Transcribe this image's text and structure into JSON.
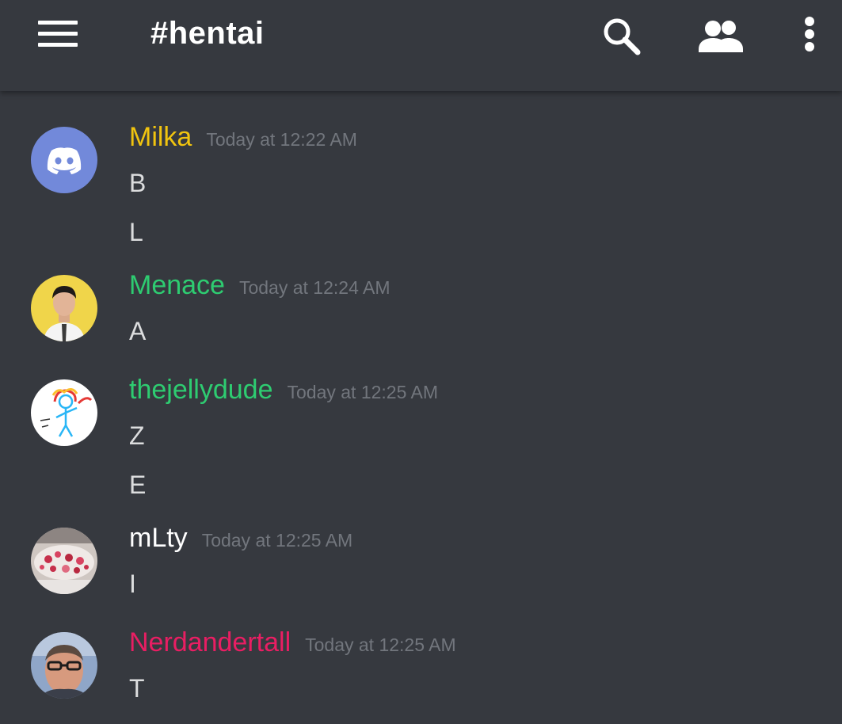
{
  "header": {
    "channel": "#hentai",
    "icons": [
      "menu-icon",
      "search-icon",
      "members-icon",
      "more-vertical-icon"
    ]
  },
  "colors": {
    "background": "#36393f",
    "header_text": "#ffffff",
    "timestamp": "#72767d",
    "message_text": "#dcddde"
  },
  "messages": [
    {
      "username": "Milka",
      "color": "#f1c40f",
      "timestamp": "Today at 12:22 AM",
      "lines": [
        "B",
        "L"
      ],
      "avatar": "discord-default-avatar"
    },
    {
      "username": "Menace",
      "color": "#2ecc71",
      "timestamp": "Today at 12:24 AM",
      "lines": [
        "A"
      ],
      "avatar": "man-in-shirt-yellow-background"
    },
    {
      "username": "thejellydude",
      "color": "#2ecc71",
      "timestamp": "Today at 12:25 AM",
      "lines": [
        "Z",
        "E"
      ],
      "avatar": "stick-figure-drawing"
    },
    {
      "username": "mLty",
      "color": "#ffffff",
      "timestamp": "Today at 12:25 AM",
      "lines": [
        "I"
      ],
      "avatar": "pink-cake-photo"
    },
    {
      "username": "Nerdandertall",
      "color": "#e91e63",
      "timestamp": "Today at 12:25 AM",
      "lines": [
        "T"
      ],
      "avatar": "man-with-glasses-photo"
    }
  ]
}
